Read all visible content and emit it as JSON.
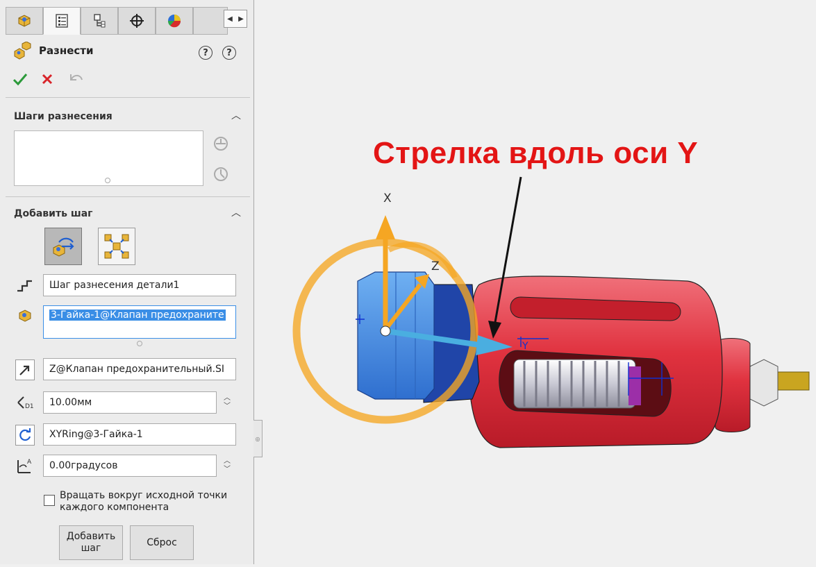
{
  "panel": {
    "title": "Разнести",
    "help_labels": [
      "?",
      "?"
    ],
    "accept_icon": "checkmark-icon",
    "cancel_icon": "x-icon",
    "undo_icon": "undo-icon",
    "tabs": [
      {
        "icon": "feature-manager-icon"
      },
      {
        "icon": "property-manager-icon"
      },
      {
        "icon": "configuration-manager-icon"
      },
      {
        "icon": "dimxpert-icon"
      },
      {
        "icon": "display-manager-icon"
      }
    ]
  },
  "explode_steps": {
    "title": "Шаги разнесения"
  },
  "add_step": {
    "title": "Добавить шаг",
    "step_name": "Шаг разнесения детали1",
    "component": "3-Гайка-1@Клапан предохраните",
    "direction": "Z@Клапан предохранительный.SI",
    "distance": "10.00мм",
    "rotation_axis": "XYRing@3-Гайка-1",
    "angle": "0.00градусов",
    "checkbox_label_line1": "Вращать вокруг исходной точки",
    "checkbox_label_line2": "каждого компонента",
    "checkbox_checked": false,
    "add_button_line1": "Добавить",
    "add_button_line2": "шаг",
    "reset_button": "Сброс"
  },
  "viewport": {
    "annotation": "Стрелка вдоль оси Y",
    "annotation_color": "#e31515",
    "axis_labels": {
      "x": "X",
      "z": "Z",
      "y": "Y"
    },
    "colors": {
      "body": "#e0323f",
      "nut": "#4a90e0",
      "ring": "#f5a623",
      "spring": "#c9c9d4"
    }
  }
}
